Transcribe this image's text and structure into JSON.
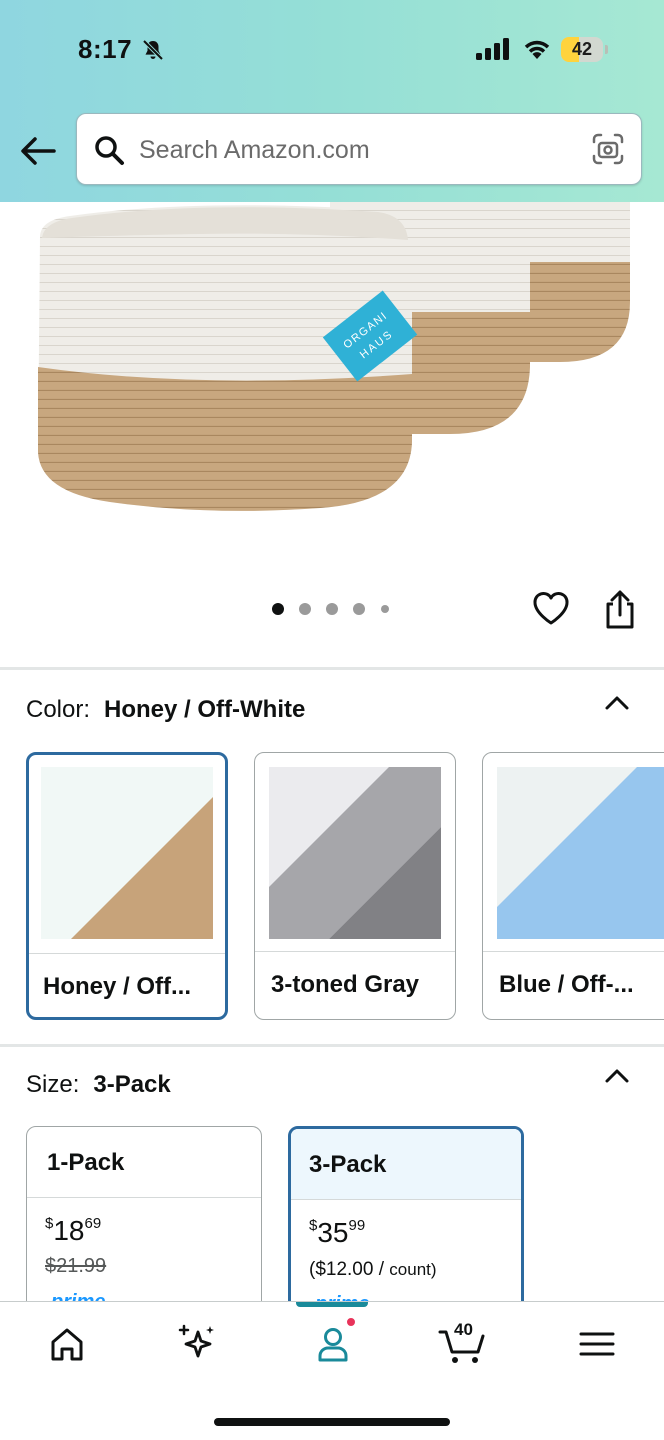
{
  "status_bar": {
    "time": "8:17",
    "battery": "42",
    "battery_level": 0.42
  },
  "search": {
    "placeholder": "Search Amazon.com"
  },
  "product": {
    "brand_tag_line1": "ORGANI",
    "brand_tag_line2": "HAUS",
    "image_count": 5,
    "active_image_index": 0
  },
  "color_section": {
    "key": "Color:",
    "value": "Honey / Off-White",
    "options": [
      {
        "label": "Honey / Off...",
        "selected": true
      },
      {
        "label": "3-toned Gray",
        "selected": false
      },
      {
        "label": "Blue / Off-...",
        "selected": false
      }
    ]
  },
  "size_section": {
    "key": "Size:",
    "value": "3-Pack",
    "options": [
      {
        "label": "1-Pack",
        "price_symbol": "$",
        "price_dollars": "18",
        "price_cents": "69",
        "list_price": "$21.99",
        "prime": "prime",
        "selected": false
      },
      {
        "label": "3-Pack",
        "price_symbol": "$",
        "price_dollars": "35",
        "price_cents": "99",
        "unit_price_main": "($12.00 / ",
        "unit_price_small": "count)",
        "prime": "prime",
        "selected": true
      }
    ]
  },
  "bottom_nav": {
    "items": [
      "home-icon",
      "sparkle-icon",
      "account-icon",
      "cart-icon",
      "menu-icon"
    ],
    "cart_count": "40",
    "active": "account-icon"
  },
  "colors": {
    "header_start": "#8fd6e0",
    "header_end": "#a6e8d3",
    "selected_border": "#2d6a9f",
    "active_nav": "#1a8a9a",
    "badge": "#e8335a",
    "prime_blue": "#1a98ff"
  }
}
